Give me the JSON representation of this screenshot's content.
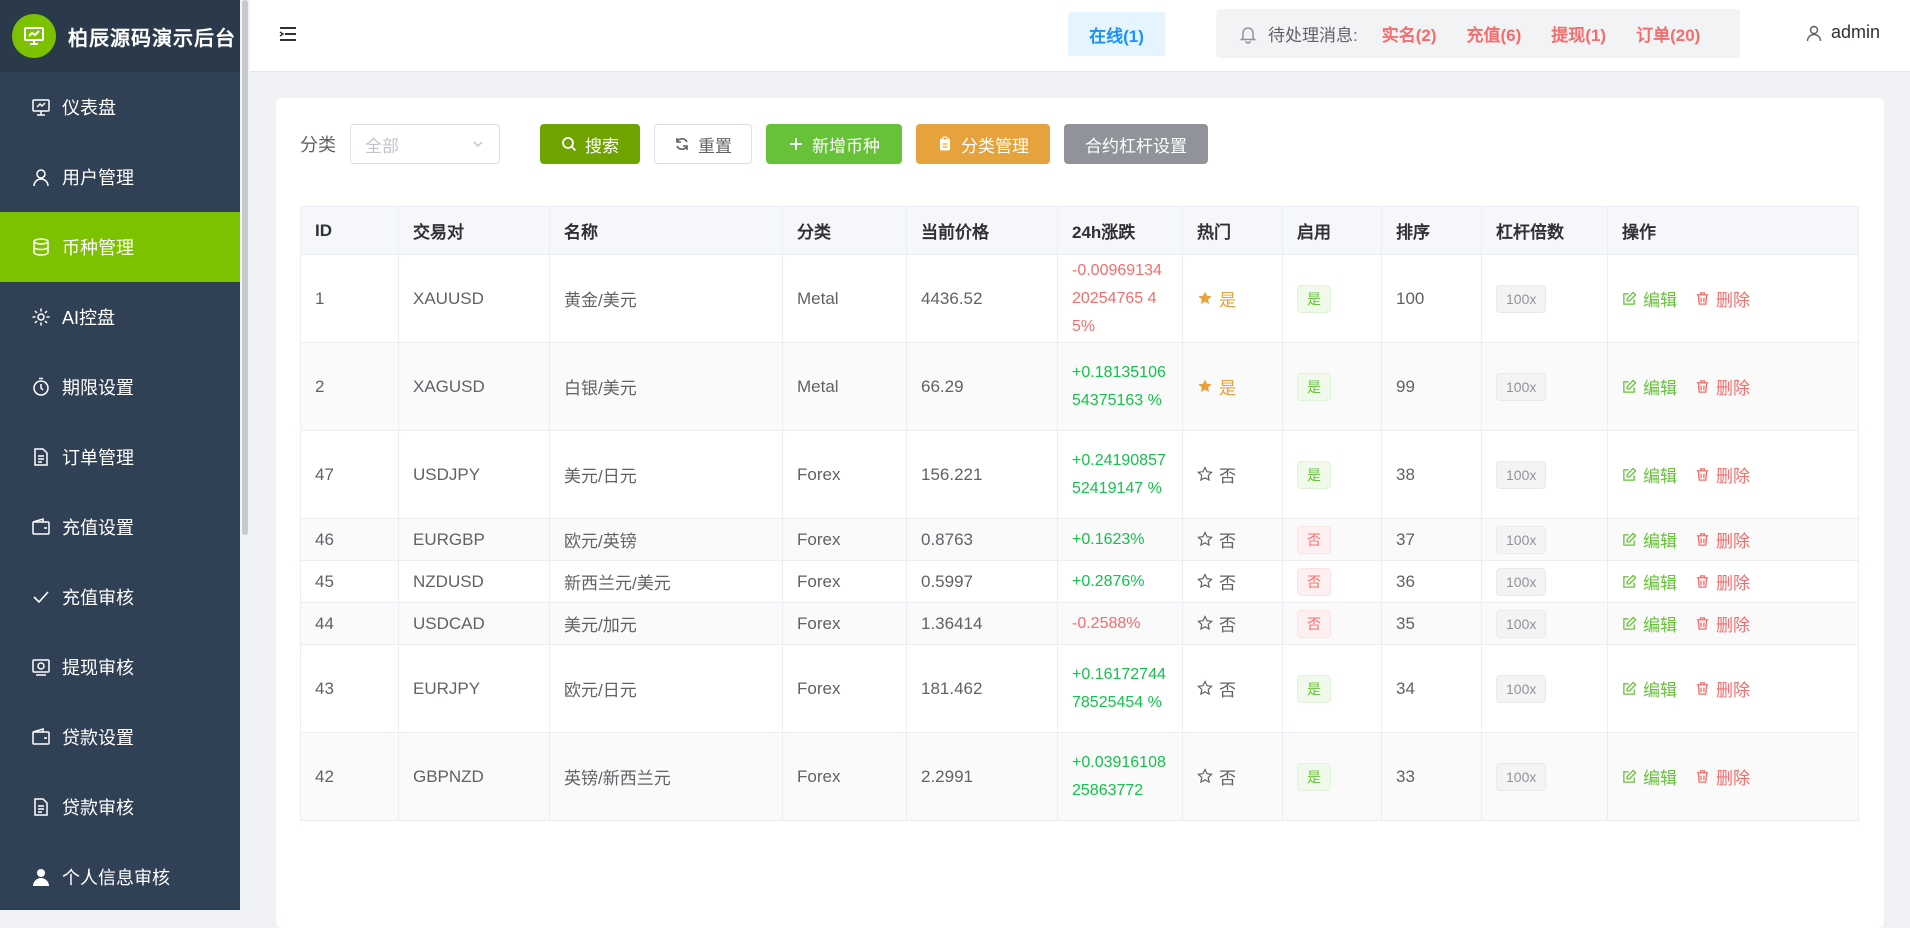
{
  "app": {
    "title": "柏辰源码演示后台"
  },
  "sidebar": {
    "items": [
      {
        "label": "仪表盘",
        "icon": "dashboard-icon",
        "active": false
      },
      {
        "label": "用户管理",
        "icon": "user-icon",
        "active": false
      },
      {
        "label": "币种管理",
        "icon": "database-icon",
        "active": true
      },
      {
        "label": "AI控盘",
        "icon": "gear-icon",
        "active": false
      },
      {
        "label": "期限设置",
        "icon": "timer-icon",
        "active": false
      },
      {
        "label": "订单管理",
        "icon": "document-icon",
        "active": false
      },
      {
        "label": "充值设置",
        "icon": "wallet-icon",
        "active": false
      },
      {
        "label": "充值审核",
        "icon": "check-icon",
        "active": false
      },
      {
        "label": "提现审核",
        "icon": "money-icon",
        "active": false
      },
      {
        "label": "贷款设置",
        "icon": "wallet-icon",
        "active": false
      },
      {
        "label": "贷款审核",
        "icon": "document-icon",
        "active": false
      },
      {
        "label": "个人信息审核",
        "icon": "person-icon",
        "active": false
      }
    ]
  },
  "header": {
    "online": "在线(1)",
    "pending_label": "待处理消息:",
    "pending": [
      "实名(2)",
      "充值(6)",
      "提现(1)",
      "订单(20)"
    ],
    "user": "admin"
  },
  "toolbar": {
    "category_label": "分类",
    "category_placeholder": "全部",
    "search": "搜索",
    "reset": "重置",
    "add": "新增币种",
    "category_manage": "分类管理",
    "leverage_settings": "合约杠杆设置"
  },
  "table": {
    "columns": [
      "ID",
      "交易对",
      "名称",
      "分类",
      "当前价格",
      "24h涨跌",
      "热门",
      "启用",
      "排序",
      "杠杆倍数",
      "操作"
    ],
    "edit_label": "编辑",
    "delete_label": "删除",
    "rows": [
      {
        "id": "1",
        "pair": "XAUUSD",
        "name": "黄金/美元",
        "category": "Metal",
        "price": "4436.52",
        "change": "-0.0096913420254765 45%",
        "change_sign": "neg",
        "hot": "是",
        "hot_flag": true,
        "enabled": "是",
        "enabled_flag": true,
        "sort": "100",
        "leverage": "100x"
      },
      {
        "id": "2",
        "pair": "XAGUSD",
        "name": "白银/美元",
        "category": "Metal",
        "price": "66.29",
        "change": "+0.1813510654375163 %",
        "change_sign": "pos",
        "hot": "是",
        "hot_flag": true,
        "enabled": "是",
        "enabled_flag": true,
        "sort": "99",
        "leverage": "100x"
      },
      {
        "id": "47",
        "pair": "USDJPY",
        "name": "美元/日元",
        "category": "Forex",
        "price": "156.221",
        "change": "+0.2419085752419147 %",
        "change_sign": "pos",
        "hot": "否",
        "hot_flag": false,
        "enabled": "是",
        "enabled_flag": true,
        "sort": "38",
        "leverage": "100x"
      },
      {
        "id": "46",
        "pair": "EURGBP",
        "name": "欧元/英镑",
        "category": "Forex",
        "price": "0.8763",
        "change": "+0.1623%",
        "change_sign": "pos",
        "hot": "否",
        "hot_flag": false,
        "enabled": "否",
        "enabled_flag": false,
        "sort": "37",
        "leverage": "100x"
      },
      {
        "id": "45",
        "pair": "NZDUSD",
        "name": "新西兰元/美元",
        "category": "Forex",
        "price": "0.5997",
        "change": "+0.2876%",
        "change_sign": "pos",
        "hot": "否",
        "hot_flag": false,
        "enabled": "否",
        "enabled_flag": false,
        "sort": "36",
        "leverage": "100x"
      },
      {
        "id": "44",
        "pair": "USDCAD",
        "name": "美元/加元",
        "category": "Forex",
        "price": "1.36414",
        "change": "-0.2588%",
        "change_sign": "neg",
        "hot": "否",
        "hot_flag": false,
        "enabled": "否",
        "enabled_flag": false,
        "sort": "35",
        "leverage": "100x"
      },
      {
        "id": "43",
        "pair": "EURJPY",
        "name": "欧元/日元",
        "category": "Forex",
        "price": "181.462",
        "change": "+0.1617274478525454 %",
        "change_sign": "pos",
        "hot": "否",
        "hot_flag": false,
        "enabled": "是",
        "enabled_flag": true,
        "sort": "34",
        "leverage": "100x"
      },
      {
        "id": "42",
        "pair": "GBPNZD",
        "name": "英镑/新西兰元",
        "category": "Forex",
        "price": "2.2991",
        "change": "+0.0391610825863772",
        "change_sign": "pos",
        "hot": "否",
        "hot_flag": false,
        "enabled": "是",
        "enabled_flag": true,
        "sort": "33",
        "leverage": "100x"
      }
    ]
  },
  "colors": {
    "sidebar": "#304156",
    "accent": "#7dc200",
    "danger": "#f56c6c",
    "success": "#67c23a",
    "warning": "#e6a23c"
  }
}
